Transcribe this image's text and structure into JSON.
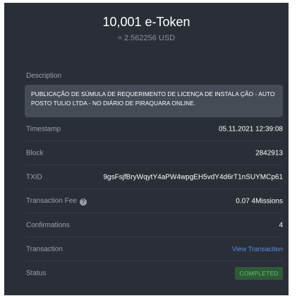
{
  "header": {
    "amount": "10,001 e-Token",
    "usd": "≈ 2.562256 USD"
  },
  "description": {
    "label": "Description",
    "text": "PUBLICAÇÃO DE SÚMULA DE REQUERIMENTO DE LICENÇA DE INSTALA ÇÃO - AUTO POSTO TULIO LTDA - NO DIÁRIO DE PIRAQUARA ONLINE."
  },
  "details": {
    "timestamp": {
      "label": "Timestamp",
      "value": "05.11.2021 12:39:08"
    },
    "block": {
      "label": "Block",
      "value": "2842913"
    },
    "txid": {
      "label": "TXID",
      "value": "9gsFsjfBryWqytY4aPW4wpgEH5vdY4d6rT1nSUYMCp61"
    },
    "fee": {
      "label": "Transaction Fee",
      "value": "0.07 4Missions",
      "help_icon": "?"
    },
    "confirmations": {
      "label": "Confirmations",
      "value": "4"
    },
    "transaction": {
      "label": "Transaction",
      "link": "View Transaction"
    },
    "status": {
      "label": "Status",
      "value": "COMPLETED"
    }
  },
  "colors": {
    "card_bg": "#2a2f37",
    "link": "#5c8ee8",
    "status_text": "#66c06f",
    "status_bg": "#2f5a38"
  }
}
